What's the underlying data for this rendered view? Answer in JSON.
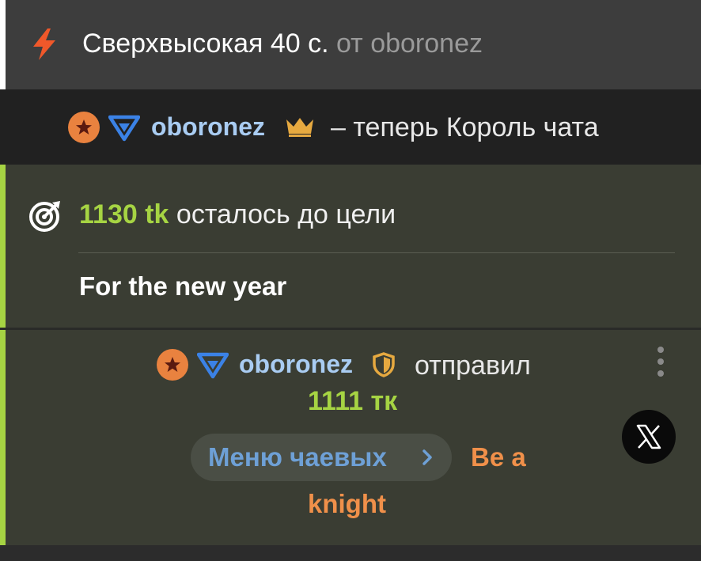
{
  "speed_event": {
    "icon": "lightning-icon",
    "main_text": "Сверхвысокая 40 с.",
    "from_text": "от oboronez",
    "accent_color": "#f0582a"
  },
  "king_event": {
    "username": "oboronez",
    "message": "– теперь Король чата",
    "icons": [
      "star-badge-icon",
      "chevron-badge-icon",
      "crown-icon"
    ]
  },
  "goal": {
    "amount": "1130 tk",
    "remaining_text": "осталось до цели",
    "title": "For the new year",
    "accent_color": "#a6d443"
  },
  "tip_event": {
    "username": "oboronez",
    "action": "отправил",
    "amount": "1111 тк",
    "menu_label": "Меню чаевых",
    "item_line1": "Be a",
    "item_line2": "knight",
    "icons": [
      "star-badge-icon",
      "chevron-badge-icon",
      "shield-icon",
      "more-icon",
      "x-logo-icon"
    ]
  }
}
